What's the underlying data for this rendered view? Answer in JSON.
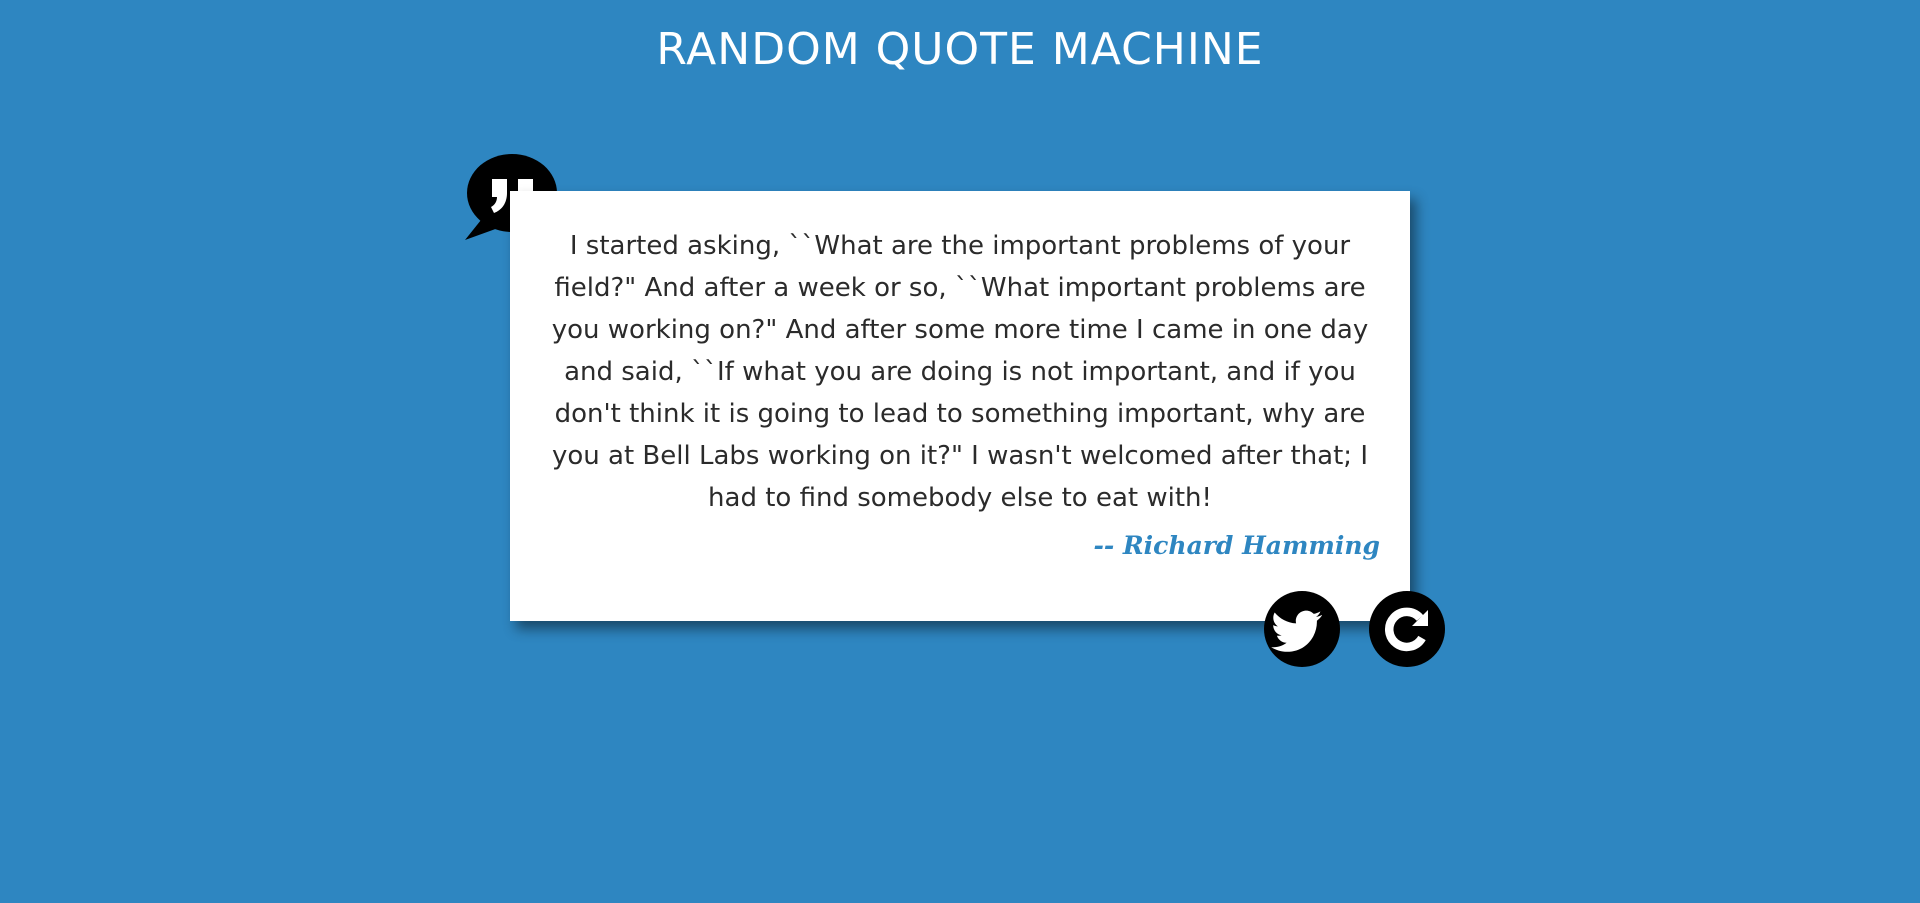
{
  "header": {
    "title": "RANDOM QUOTE MACHINE"
  },
  "quote": {
    "text": "I started asking, ``What are the important problems of your field?\" And after a week or so, ``What important problems are you working on?\" And after some more time I came in one day and said, ``If what you are doing is not important, and if you don't think it is going to lead to something important, why are you at Bell Labs working on it?\" I wasn't welcomed after that; I had to find somebody else to eat with!",
    "author": "-- Richard Hamming"
  },
  "icons": {
    "quote_bubble": "quote-bubble-icon",
    "tweet": "twitter-bird-icon",
    "new_quote": "refresh-icon"
  },
  "colors": {
    "background": "#2e86c1",
    "card": "#ffffff",
    "author": "#2e86c1",
    "buttons": "#000000"
  }
}
